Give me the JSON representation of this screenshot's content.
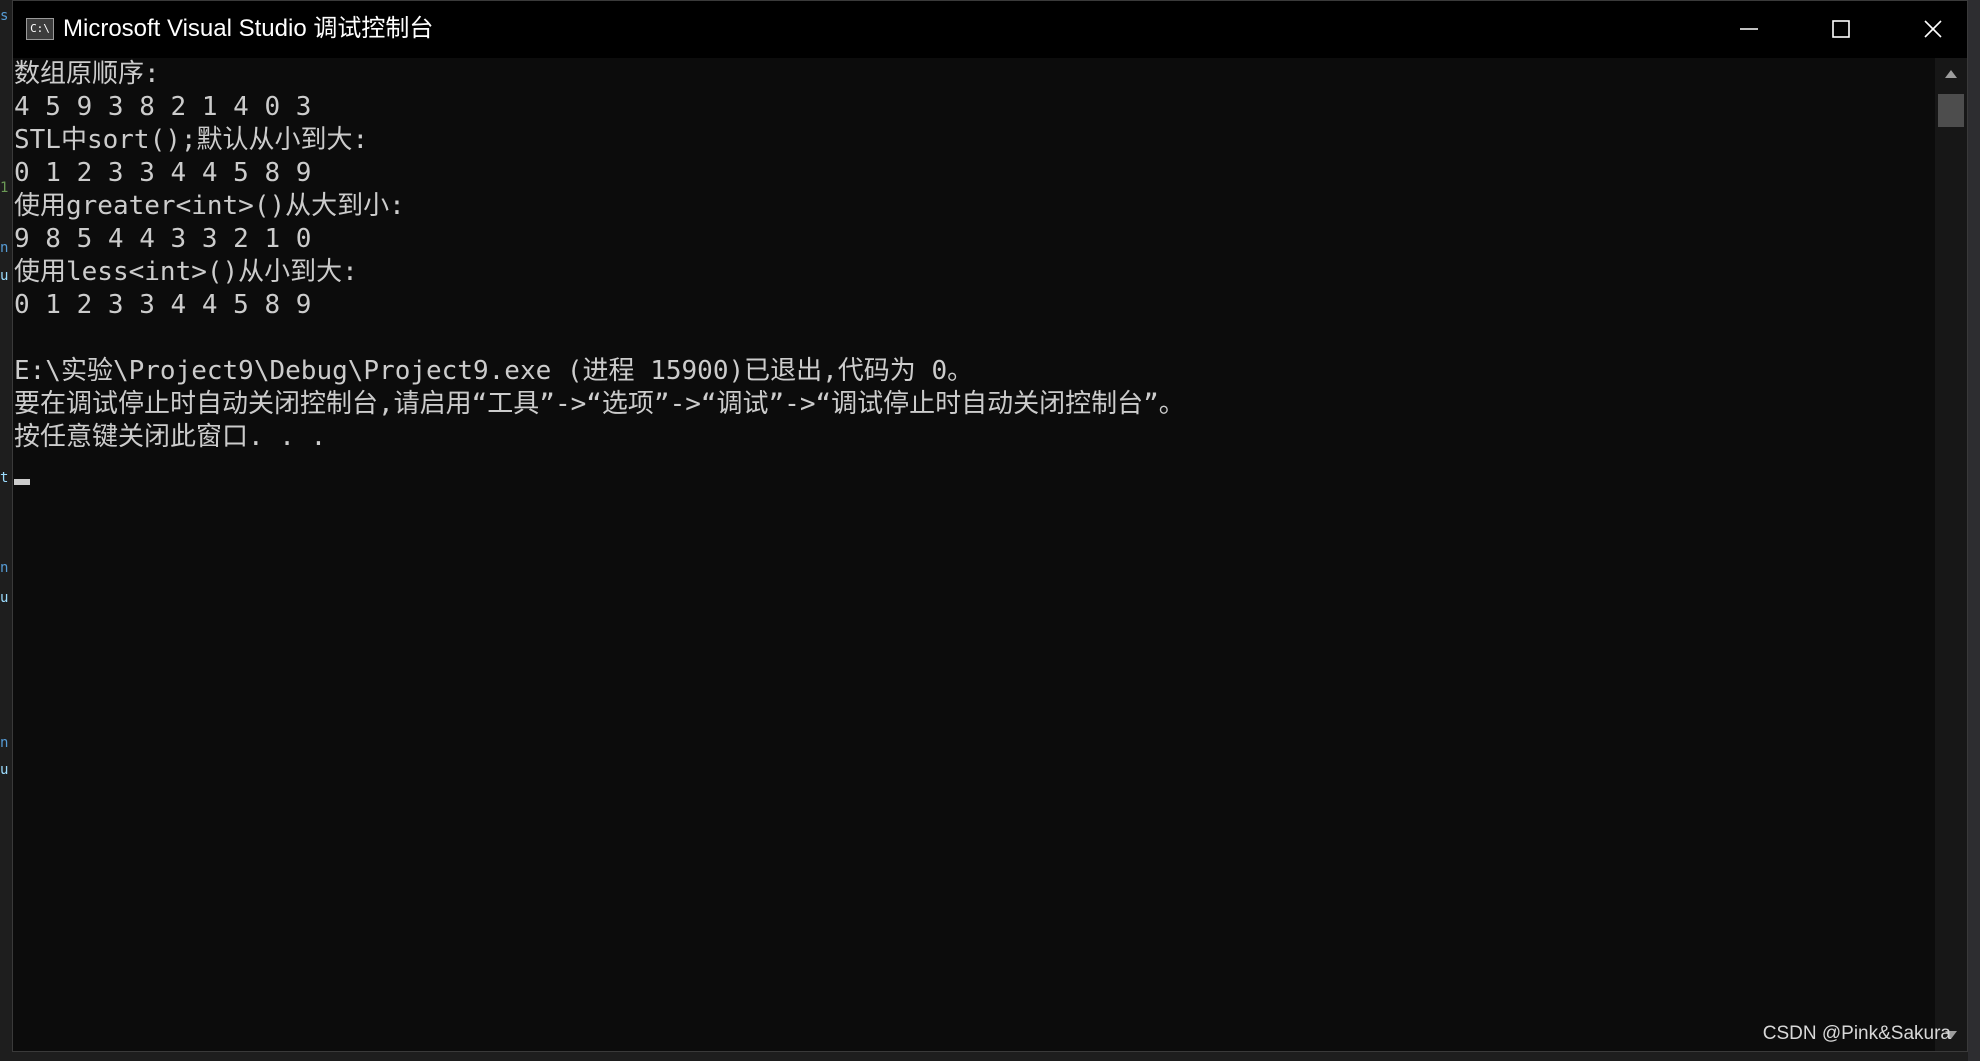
{
  "window": {
    "title": "Microsoft Visual Studio 调试控制台",
    "icon_label": "C:\\",
    "icon": "console-app-icon",
    "controls": {
      "minimize_icon": "minimize-icon",
      "maximize_icon": "maximize-icon",
      "close_icon": "close-icon"
    }
  },
  "console": {
    "lines": [
      "数组原顺序:",
      "4 5 9 3 8 2 1 4 0 3",
      "STL中sort();默认从小到大:",
      "0 1 2 3 3 4 4 5 8 9",
      "使用greater<int>()从大到小:",
      "9 8 5 4 4 3 3 2 1 0",
      "使用less<int>()从小到大:",
      "0 1 2 3 3 4 4 5 8 9",
      "",
      "E:\\实验\\Project9\\Debug\\Project9.exe (进程 15900)已退出,代码为 0。",
      "要在调试停止时自动关闭控制台,请启用“工具”->“选项”->“调试”->“调试停止时自动关闭控制台”。",
      "按任意键关闭此窗口. . ."
    ],
    "text_color": "#cccccc",
    "background": "#0c0c0c"
  },
  "scrollbar": {
    "up_icon": "scroll-up-arrow-icon",
    "down_icon": "scroll-down-arrow-icon"
  },
  "watermark": "CSDN @Pink&Sakura"
}
